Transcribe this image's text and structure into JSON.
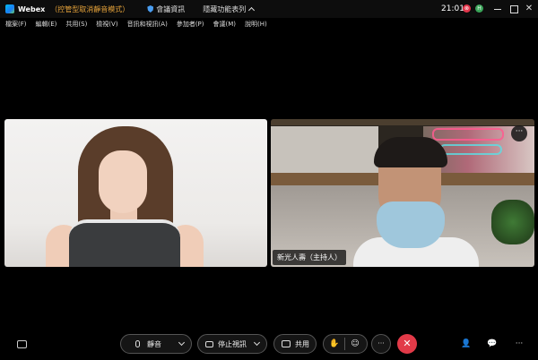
{
  "titlebar": {
    "app_name": "Webex",
    "mode": "（控管型取消靜音模式）",
    "meeting_info": "會議資訊",
    "hide_menu": "隱藏功能表列",
    "clock": "21:01",
    "status_red": "⊗",
    "status_green": "H"
  },
  "menu": {
    "items": [
      "檔案(F)",
      "編輯(E)",
      "共用(S)",
      "檢視(V)",
      "音訊和視訊(A)",
      "參加者(P)",
      "會議(M)",
      "說明(H)"
    ]
  },
  "participants": {
    "right_name": "新光人壽（主持人）",
    "more": "···"
  },
  "toolbar": {
    "mute_label": "靜音",
    "stop_video_label": "停止視訊",
    "share_label": "共用",
    "more_label": "···",
    "end_label": "✕",
    "right_more": "···"
  },
  "colors": {
    "end_call": "#e23a48",
    "mode_text": "#e6a33a",
    "brand": "#00bceb"
  }
}
